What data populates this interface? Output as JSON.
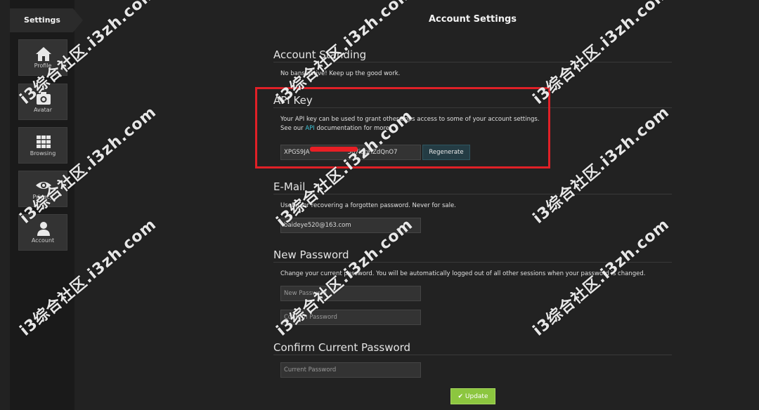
{
  "sidebar": {
    "title": "Settings",
    "items": [
      {
        "label": "Profile",
        "icon": "home-icon"
      },
      {
        "label": "Avatar",
        "icon": "camera-icon"
      },
      {
        "label": "Browsing",
        "icon": "grid-icon"
      },
      {
        "label": "Privacy",
        "icon": "eye-icon"
      },
      {
        "label": "Account",
        "icon": "user-icon"
      }
    ]
  },
  "header": {
    "title": "Account Settings"
  },
  "standing": {
    "title": "Account Standing",
    "text": "No bans active! Keep up the good work."
  },
  "api_key": {
    "title": "API Key",
    "desc_line1": "Your API key can be used to grant other apps access to some of your account settings.",
    "desc_prefix": "See our ",
    "desc_link": "API",
    "desc_suffix": " documentation for more.",
    "value": "XPGS9JA                    5o7iupHZdQnO7",
    "regenerate_label": "Regenerate"
  },
  "email": {
    "title": "E-Mail",
    "desc": "Useful for recovering a forgotten password. Never for sale.",
    "value": "baideye520@163.com"
  },
  "new_password": {
    "title": "New Password",
    "desc": "Change your current password. You will be automatically logged out of all other sessions when your password is changed.",
    "placeholder_new": "New Password",
    "placeholder_confirm": "Confirm Password"
  },
  "confirm_current": {
    "title": "Confirm Current Password",
    "placeholder": "Current Password"
  },
  "update_label": "Update",
  "watermark_text": "i3综合社区.i3zh.com",
  "colors": {
    "accent_link": "#3ec3d6",
    "update_green": "#8cc63f",
    "highlight_red": "#e02027"
  }
}
